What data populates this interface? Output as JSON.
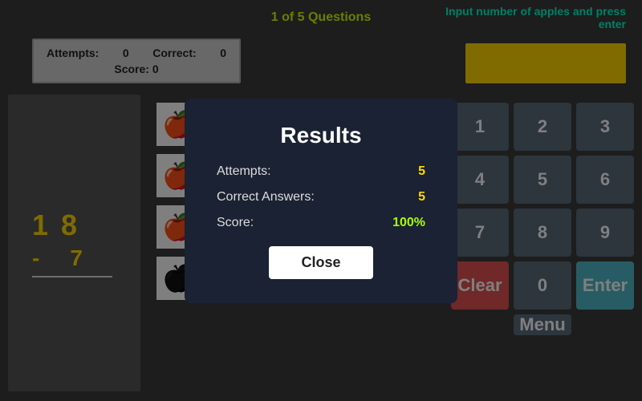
{
  "header": {
    "questions_label": "1 of 5 Questions",
    "input_instruction": "Input number of apples and press enter"
  },
  "stats": {
    "attempts_label": "Attempts:",
    "attempts_value": "0",
    "correct_label": "Correct:",
    "correct_value": "0",
    "score_label": "Score:",
    "score_value": "0"
  },
  "math": {
    "number1": "1  8",
    "operator": "-",
    "number2": "7"
  },
  "numpad": {
    "buttons": [
      "1",
      "2",
      "3",
      "4",
      "5",
      "6",
      "7",
      "8",
      "9",
      "Clear",
      "0",
      "Enter"
    ],
    "clear_label": "Clear",
    "zero_label": "0",
    "enter_label": "Enter",
    "menu_label": "Menu"
  },
  "results": {
    "title": "Results",
    "attempts_label": "Attempts:",
    "attempts_value": "5",
    "correct_label": "Correct Answers:",
    "correct_value": "5",
    "score_label": "Score:",
    "score_value": "100%",
    "close_label": "Close"
  },
  "apple_grid": {
    "cells": [
      {
        "type": "red"
      },
      {
        "type": "red"
      },
      {
        "type": "empty"
      },
      {
        "type": "empty"
      },
      {
        "type": "empty"
      },
      {
        "type": "red"
      },
      {
        "type": "red"
      },
      {
        "type": "empty"
      },
      {
        "type": "empty"
      },
      {
        "type": "empty"
      },
      {
        "type": "red"
      },
      {
        "type": "black"
      },
      {
        "type": "black"
      },
      {
        "type": "black"
      },
      {
        "type": "empty"
      },
      {
        "type": "black"
      },
      {
        "type": "black"
      },
      {
        "type": "black"
      },
      {
        "type": "empty"
      },
      {
        "type": "empty"
      }
    ]
  }
}
